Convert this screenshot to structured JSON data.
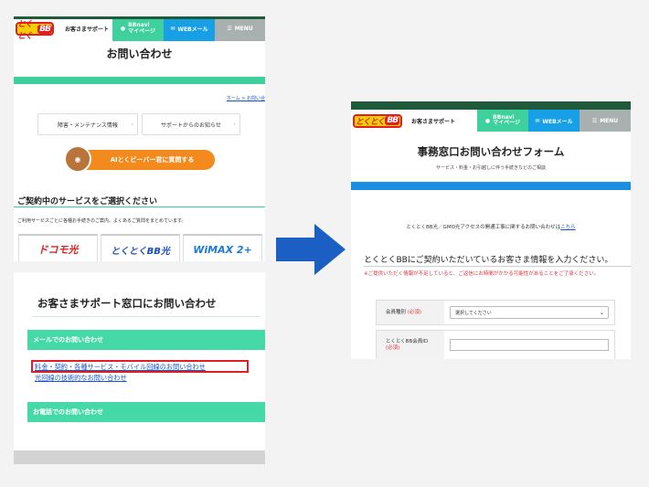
{
  "header": {
    "logo_text": "とくとく",
    "logo_bb": "BB",
    "support_label": "お客さまサポート",
    "bbnavi_line1": "BBnavi",
    "bbnavi_line2": "マイページ",
    "webmail_label": "WEBメール",
    "menu_label": "MENU"
  },
  "left_top": {
    "title": "お問い合わせ",
    "breadcrumb": "ホーム > お問い合",
    "btn_maintenance": "障害・メンテナンス情報",
    "btn_notice": "サポートからのお知らせ",
    "ai_button": "AIとくビーバー君に質問する",
    "services_heading": "ご契約中のサービスをご選択ください",
    "services_desc": "ご利用サービスごとに各種お手続きのご案内、よくあるご質問をまとめています。",
    "services": [
      "ドコモ光",
      "とくとくBB光",
      "WiMAX 2+"
    ]
  },
  "left_bottom": {
    "title": "お客さまサポート窓口にお問い合わせ",
    "email_section": "メールでのお問い合わせ",
    "link_billing": "料金・契約・各種サービス・モバイル回線のお問い合わせ",
    "link_tech": "光回線の技術的なお問い合わせ",
    "phone_section": "お電話でのお問い合わせ"
  },
  "right": {
    "title": "事務窓口お問い合わせフォーム",
    "subtitle": "サービス・料金・お引越しに伴う手続きなどのご相談",
    "note_prefix": "とくとくBB光／GMO光アクセスの開通工事に関するお問い合わせは",
    "note_link": "こちら",
    "form_heading": "とくとくBBにご契約いただいているお客さま情報を入力ください。",
    "warning": "※ご提供いただく情報が不足していると、ご返信にお時間がかかる可能性があることをご了承ください。",
    "field1_label": "会員種別",
    "field1_required": "(必須)",
    "field1_value": "選択してください",
    "field2_label": "とくとくBB会員ID",
    "field2_required": "(必須)"
  },
  "colors": {
    "accent_green": "#3fd19d",
    "webmail_blue": "#18a0e6",
    "form_band_blue": "#1a8ee0",
    "arrow_blue": "#1b5fc4",
    "highlight_red": "#e01e2a",
    "ai_orange": "#f28a1e"
  }
}
